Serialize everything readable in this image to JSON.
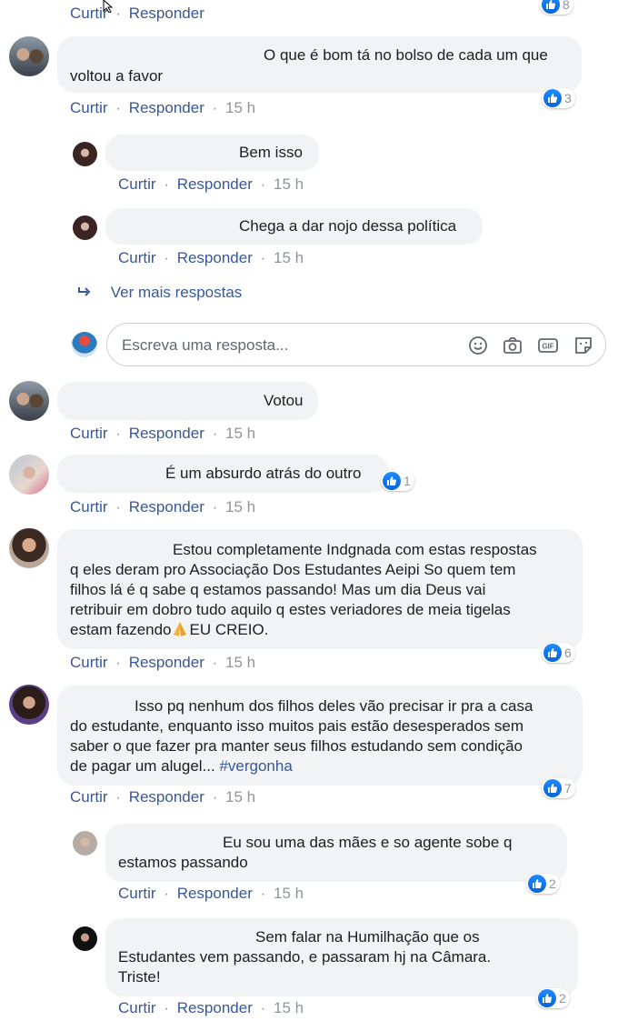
{
  "labels": {
    "like": "Curtir",
    "reply": "Responder",
    "dot": "·"
  },
  "top": {
    "reactions": "8"
  },
  "comments": [
    {
      "time": "15 h",
      "line1": "O que é bom tá no bolso de cada um que",
      "line2": "voltou a favor",
      "reactions": "3"
    },
    {
      "time": "15 h",
      "text": "Bem isso"
    },
    {
      "time": "15 h",
      "text": "Chega a dar nojo dessa política"
    },
    {
      "time": "15 h",
      "text": "Votou"
    },
    {
      "time": "15 h",
      "text": "É um absurdo atrás do outro",
      "reactions": "1"
    },
    {
      "time": "15 h",
      "line1": "Estou completamente Indgnada com estas respostas",
      "line2": "q eles deram pro Associação Dos Estudantes Aeipi So quem tem",
      "line3": "filhos lá é q sabe q estamos passando! Mas um dia Deus vai",
      "line4": "retribuir em dobro tudo aquilo q estes veriadores de meia tigelas",
      "line5": "estam fazendo",
      "line5b": "EU CREIO.",
      "reactions": "6"
    },
    {
      "time": "15 h",
      "line1": "Isso pq nenhum dos filhos deles vão precisar ir pra a casa",
      "line2": "do estudante, enquanto isso muitos pais estão desesperados sem",
      "line3": "saber o que fazer pra manter seus filhos estudando sem condição",
      "line4": "de pagar um alugel...",
      "hashtag": "#vergonha",
      "reactions": "7"
    },
    {
      "time": "15 h",
      "line1": "Eu sou uma das mães e so agente sobe q",
      "line2": "estamos passando",
      "reactions": "2"
    },
    {
      "time": "15 h",
      "line1": "Sem falar na Humilhação que os",
      "line2": "Estudantes vem passando, e passaram hj na Câmara.",
      "line3": "Triste!",
      "reactions": "2"
    }
  ],
  "see_more": "Ver mais respostas",
  "reply_placeholder": "Escreva uma resposta...",
  "icons": {
    "emoji": "smiley-icon",
    "camera": "camera-icon",
    "gif": "gif-icon",
    "sticker": "sticker-icon",
    "reply_arrow": "reply-arrow-icon",
    "like": "thumbs-up-icon",
    "pray": "praying-hands-emoji"
  },
  "colors": {
    "link": "#385898",
    "bubble": "#f2f3f5",
    "like": "#1877f2",
    "muted": "#90949c"
  }
}
